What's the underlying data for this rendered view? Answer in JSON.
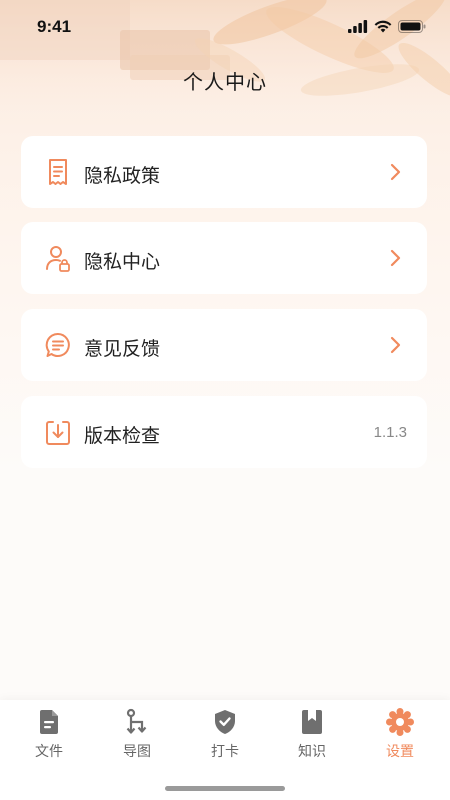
{
  "status_bar": {
    "time": "9:41"
  },
  "page": {
    "title": "个人中心"
  },
  "menu": {
    "items": [
      {
        "label": "隐私政策",
        "icon": "document-icon",
        "has_chevron": true
      },
      {
        "label": "隐私中心",
        "icon": "user-lock-icon",
        "has_chevron": true
      },
      {
        "label": "意见反馈",
        "icon": "chat-bubble-icon",
        "has_chevron": true
      },
      {
        "label": "版本检查",
        "icon": "download-box-icon",
        "value": "1.1.3"
      }
    ]
  },
  "tabbar": {
    "tabs": [
      {
        "label": "文件",
        "icon": "file-icon",
        "active": false
      },
      {
        "label": "导图",
        "icon": "mindmap-icon",
        "active": false
      },
      {
        "label": "打卡",
        "icon": "checkin-badge-icon",
        "active": false
      },
      {
        "label": "知识",
        "icon": "bookmark-book-icon",
        "active": false
      },
      {
        "label": "设置",
        "icon": "settings-gear-icon",
        "active": true
      }
    ]
  },
  "colors": {
    "accent": "#f08a5d",
    "icon_gray": "#6f6f6f",
    "card_bg": "#ffffff"
  }
}
